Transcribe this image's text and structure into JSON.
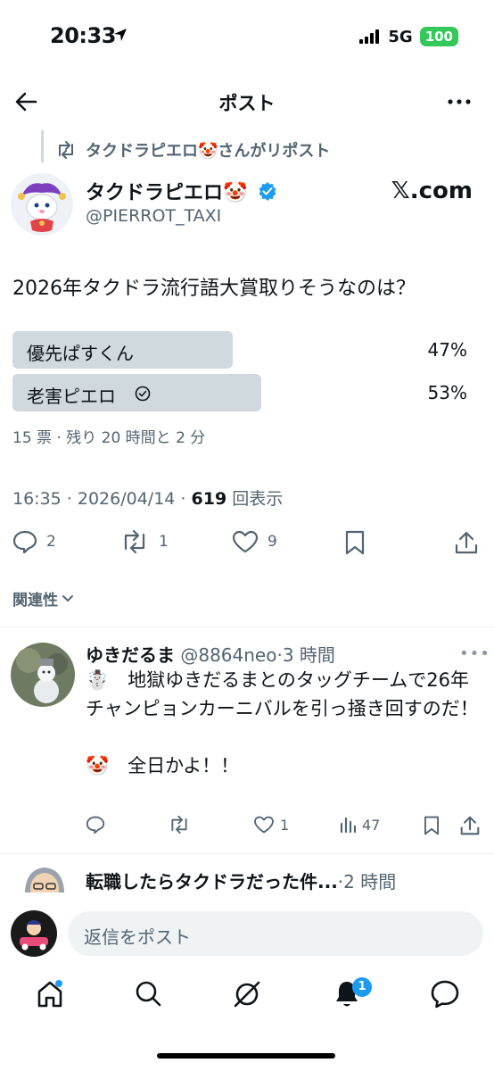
{
  "status_bar": {
    "time": "20:33",
    "network": "5G",
    "battery": "100"
  },
  "header": {
    "title": "ポスト"
  },
  "repost": {
    "text": "タクドラピエロ🤡さんがリポスト"
  },
  "author": {
    "name": "タクドラピエロ🤡",
    "handle": "@PIERROT_TAXI",
    "source": "𝕏.com"
  },
  "tweet": {
    "text": "2026年タクドラ流行語大賞取りそうなのは？"
  },
  "poll": {
    "options": [
      {
        "label": "優先ぱすくん",
        "percent": "47%",
        "fraction": 0.47
      },
      {
        "label": "老害ピエロ",
        "percent": "53%",
        "fraction": 0.53
      }
    ],
    "meta": "15 票 · 残り 20 時間と 2 分"
  },
  "timestamp": {
    "time": "16:35 · 2026/04/14 · ",
    "views": "619",
    "views_label": " 回表示"
  },
  "actions": {
    "replies": "2",
    "reposts": "1",
    "likes": "9"
  },
  "related": {
    "label": "関連性"
  },
  "reply1": {
    "name": "ゆきだるま",
    "meta": " @8864neo·3 時間",
    "line1": "☃️　地獄ゆきだるまとのタッグチームで26年チャンピョンカーニバルを引っ掻き回すのだ！",
    "line2": "🤡　全日かよ！！",
    "likes": "1",
    "views": "47"
  },
  "reply2": {
    "name": "転職したらタクドラだった件...",
    "meta": "·2 時間"
  },
  "compose": {
    "placeholder": "返信をポスト"
  },
  "notifications": {
    "badge": "1"
  },
  "colors": {
    "accent": "#1d9bf0",
    "poll_bar": "#cfd9de",
    "secondary_text": "#536471"
  },
  "icons": [
    "back-arrow-icon",
    "more-icon",
    "repost-icon",
    "verified-icon",
    "reply-icon",
    "like-icon",
    "bookmark-icon",
    "share-icon",
    "analytics-icon",
    "home-icon",
    "search-icon",
    "grok-icon",
    "bell-icon",
    "messages-icon"
  ]
}
